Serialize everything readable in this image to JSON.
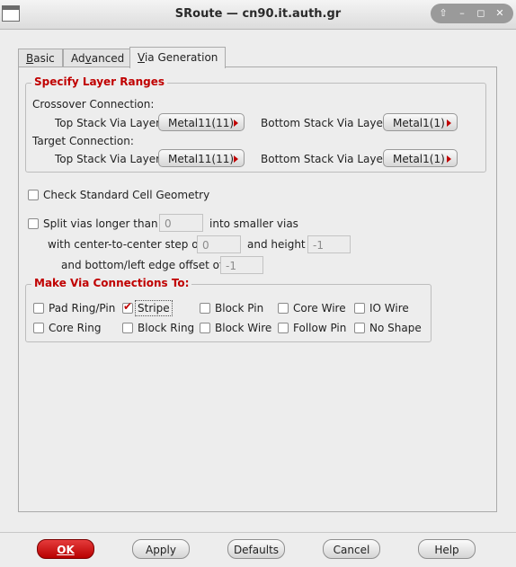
{
  "window": {
    "title": "SRoute — cn90.it.auth.gr",
    "controls": [
      "⇧",
      "–",
      "◻",
      "✕"
    ]
  },
  "tabs": [
    {
      "label": "Basic",
      "accel": "B",
      "rest": "asic"
    },
    {
      "label": "Advanced",
      "accel": "v",
      "pre": "Ad",
      "rest": "anced"
    },
    {
      "label": "Via Generation",
      "accel": "V",
      "rest": "ia Generation",
      "active": true
    }
  ],
  "layer_ranges": {
    "title": "Specify Layer Ranges",
    "crossover_label": "Crossover Connection:",
    "target_label": "Target Connection:",
    "top_stack_label": "Top Stack Via Layer:",
    "bottom_stack_label": "Bottom Stack Via Layer:",
    "crossover_top": "Metal11(11)",
    "crossover_bottom": "Metal1(1)",
    "target_top": "Metal11(11)",
    "target_bottom": "Metal1(1)"
  },
  "check_std_cell": {
    "label": "Check Standard Cell Geometry",
    "checked": false
  },
  "split_vias": {
    "label": "Split vias longer than",
    "value": "0",
    "suffix": "into smaller vias",
    "step_label": "with center-to-center step of",
    "step_value": "0",
    "height_label": "and height",
    "height_value": "-1",
    "offset_label": "and bottom/left edge offset of",
    "offset_value": "-1"
  },
  "via_connections": {
    "title": "Make Via Connections To:",
    "items": [
      {
        "label": "Pad Ring/Pin",
        "checked": false
      },
      {
        "label": "Stripe",
        "checked": true
      },
      {
        "label": "Block Pin",
        "checked": false
      },
      {
        "label": "Core Wire",
        "checked": false
      },
      {
        "label": "IO Wire",
        "checked": false
      },
      {
        "label": "Core Ring",
        "checked": false
      },
      {
        "label": "Block Ring",
        "checked": false
      },
      {
        "label": "Block Wire",
        "checked": false
      },
      {
        "label": "Follow Pin",
        "checked": false
      },
      {
        "label": "No Shape",
        "checked": false
      }
    ]
  },
  "buttons": {
    "ok": "OK",
    "apply": "Apply",
    "defaults": "Defaults",
    "cancel": "Cancel",
    "help": "Help"
  },
  "colors": {
    "accent": "#c00000",
    "ok_button": "#d01010"
  }
}
